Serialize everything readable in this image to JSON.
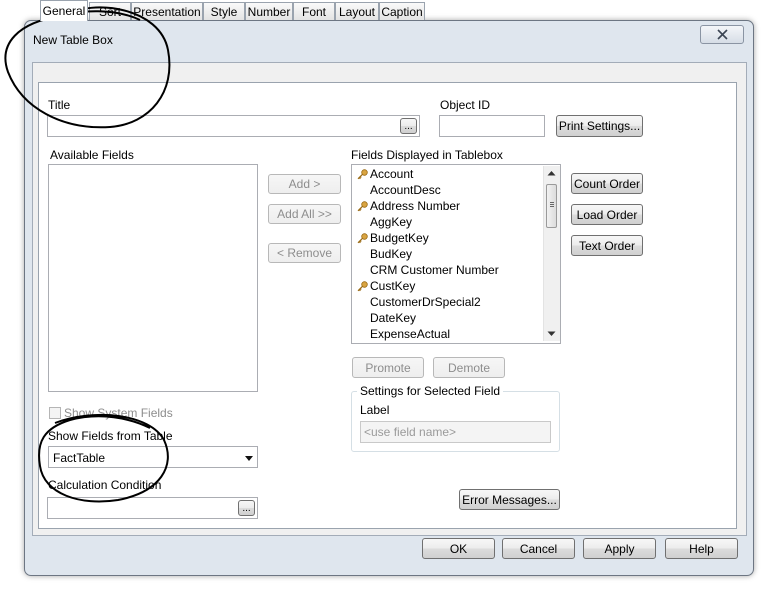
{
  "window": {
    "title": "New Table Box"
  },
  "tabs": [
    {
      "label": "General"
    },
    {
      "label": "Sort"
    },
    {
      "label": "Presentation"
    },
    {
      "label": "Style"
    },
    {
      "label": "Number"
    },
    {
      "label": "Font"
    },
    {
      "label": "Layout"
    },
    {
      "label": "Caption"
    }
  ],
  "general": {
    "title_label": "Title",
    "title_value": "",
    "ellipsis": "...",
    "object_id_label": "Object ID",
    "object_id_value": "",
    "print_settings_label": "Print Settings...",
    "available_fields_label": "Available Fields",
    "add_label": "Add >",
    "add_all_label": "Add All >>",
    "remove_label": "< Remove",
    "fields_displayed_label": "Fields Displayed in Tablebox",
    "fields": [
      {
        "name": "Account",
        "key": true
      },
      {
        "name": "AccountDesc",
        "key": false
      },
      {
        "name": "Address Number",
        "key": true
      },
      {
        "name": "AggKey",
        "key": false
      },
      {
        "name": "BudgetKey",
        "key": true
      },
      {
        "name": "BudKey",
        "key": false
      },
      {
        "name": "CRM Customer Number",
        "key": false
      },
      {
        "name": "CustKey",
        "key": true
      },
      {
        "name": "CustomerDrSpecial2",
        "key": false
      },
      {
        "name": "DateKey",
        "key": false
      },
      {
        "name": "ExpenseActual",
        "key": false
      }
    ],
    "count_order_label": "Count Order",
    "load_order_label": "Load Order",
    "text_order_label": "Text Order",
    "promote_label": "Promote",
    "demote_label": "Demote",
    "settings_group_label": "Settings for Selected Field",
    "field_label_label": "Label",
    "field_label_placeholder": "<use field name>",
    "show_system_fields_label": "Show System Fields",
    "show_fields_from_label": "Show Fields from Table",
    "show_fields_from_value": "FactTable",
    "calculation_condition_label": "Calculation Condition",
    "calculation_condition_value": "",
    "error_messages_label": "Error Messages..."
  },
  "footer": {
    "ok_label": "OK",
    "cancel_label": "Cancel",
    "apply_label": "Apply",
    "help_label": "Help"
  },
  "icons": {
    "close": "close-icon",
    "key": "key-icon",
    "dropdown": "chevron-down-icon"
  }
}
